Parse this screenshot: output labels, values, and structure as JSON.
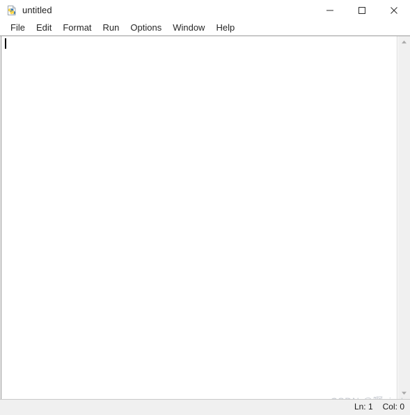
{
  "window": {
    "title": "untitled",
    "icon": "python-file-icon",
    "controls": [
      {
        "name": "minimize-button",
        "glyph": "minimize-icon",
        "label": "Minimize"
      },
      {
        "name": "maximize-button",
        "glyph": "maximize-icon",
        "label": "Maximize"
      },
      {
        "name": "close-button",
        "glyph": "close-icon",
        "label": "Close"
      }
    ]
  },
  "menubar": {
    "items": [
      {
        "label": "File"
      },
      {
        "label": "Edit"
      },
      {
        "label": "Format"
      },
      {
        "label": "Run"
      },
      {
        "label": "Options"
      },
      {
        "label": "Window"
      },
      {
        "label": "Help"
      }
    ]
  },
  "editor": {
    "content": "",
    "caret_visible": true
  },
  "scrollbar": {
    "up_arrow": "chevron-up-icon",
    "down_arrow": "chevron-down-icon"
  },
  "statusbar": {
    "line_label": "Ln: 1",
    "col_label": "Col: 0"
  },
  "watermark": {
    "text": "CSDN @啊qiu !"
  },
  "colors": {
    "titlebar_bg": "#ffffff",
    "menubar_bg": "#ffffff",
    "editor_bg": "#ffffff",
    "statusbar_bg": "#f0f0f0",
    "scrollbar_bg": "#f0f0f0",
    "text": "#1f1f1f",
    "watermark": "#c5c9d0",
    "python_blue": "#3c77a9",
    "python_yellow": "#ffd544"
  }
}
